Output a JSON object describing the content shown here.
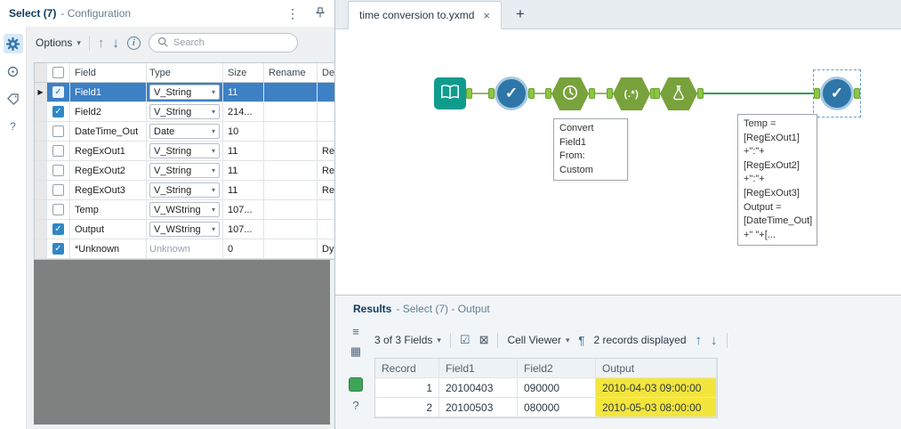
{
  "icons": {
    "kebab": "⋮",
    "chevron_down": "▾",
    "up_arrow": "↑",
    "down_arrow": "↓",
    "info": "i",
    "check": "✓",
    "row_pointer": "▶",
    "close": "×",
    "plus": "+",
    "pilcrow": "¶",
    "select_box": "☑",
    "cancel_box": "⊠",
    "list_view": "≡",
    "grid_view": "▦",
    "question": "?",
    "regex_glyph": "(.*)"
  },
  "colors": {
    "accent_blue": "#2e77ae",
    "selection_blue": "#3d80c4",
    "tool_green": "#78a23b",
    "tool_teal": "#0f9c8d",
    "tool_blue": "#2e76a8",
    "highlight_yellow": "#f4e53c",
    "navy_text": "#0d3a5c",
    "void_gray": "#7f8080"
  },
  "config_panel": {
    "title": "Select (7)",
    "subtitle": "- Configuration",
    "options_label": "Options",
    "search_placeholder": "Search",
    "table": {
      "headers": {
        "field": "Field",
        "type": "Type",
        "size": "Size",
        "rename": "Rename",
        "description": "Description"
      },
      "rows": [
        {
          "checked": true,
          "selected": true,
          "field": "Field1",
          "type": "V_String",
          "type_dropdown": true,
          "size": "11",
          "rename": "",
          "description": ""
        },
        {
          "checked": true,
          "selected": false,
          "field": "Field2",
          "type": "V_String",
          "type_dropdown": true,
          "size": "214...",
          "rename": "",
          "description": ""
        },
        {
          "checked": false,
          "selected": false,
          "field": "DateTime_Out",
          "type": "Date",
          "type_dropdown": true,
          "size": "10",
          "rename": "",
          "description": ""
        },
        {
          "checked": false,
          "selected": false,
          "field": "RegExOut1",
          "type": "V_String",
          "type_dropdown": true,
          "size": "11",
          "rename": "",
          "description": "Re"
        },
        {
          "checked": false,
          "selected": false,
          "field": "RegExOut2",
          "type": "V_String",
          "type_dropdown": true,
          "size": "11",
          "rename": "",
          "description": "Re"
        },
        {
          "checked": false,
          "selected": false,
          "field": "RegExOut3",
          "type": "V_String",
          "type_dropdown": true,
          "size": "11",
          "rename": "",
          "description": "Re"
        },
        {
          "checked": false,
          "selected": false,
          "field": "Temp",
          "type": "V_WString",
          "type_dropdown": true,
          "size": "107...",
          "rename": "",
          "description": ""
        },
        {
          "checked": true,
          "selected": false,
          "field": "Output",
          "type": "V_WString",
          "type_dropdown": true,
          "size": "107...",
          "rename": "",
          "description": ""
        },
        {
          "checked": true,
          "selected": false,
          "field": "*Unknown",
          "type": "Unknown",
          "type_dropdown": false,
          "size": "0",
          "rename": "",
          "description": "Dy"
        }
      ]
    }
  },
  "canvas": {
    "tab_label": "time conversion to.yxmd",
    "annotations": {
      "datetime": "Convert Field1\nFrom:\nCustom",
      "formula": "Temp =\n[RegExOut1]\n+\":\"+\n[RegExOut2]\n+\":\"+\n[RegExOut3]\nOutput =\n[DateTime_Out]\n+\" \"+[..."
    }
  },
  "results_panel": {
    "title": "Results",
    "subtitle": "- Select (7) - Output",
    "fields_summary": "3 of 3 Fields",
    "cell_viewer_label": "Cell Viewer",
    "records_summary": "2 records displayed",
    "grid": {
      "headers": [
        "Record",
        "Field1",
        "Field2",
        "Output"
      ],
      "rows": [
        {
          "record": "1",
          "field1": "20100403",
          "field2": "090000",
          "output": "2010-04-03 09:00:00",
          "highlight": true
        },
        {
          "record": "2",
          "field1": "20100503",
          "field2": "080000",
          "output": "2010-05-03 08:00:00",
          "highlight": true
        }
      ]
    }
  }
}
